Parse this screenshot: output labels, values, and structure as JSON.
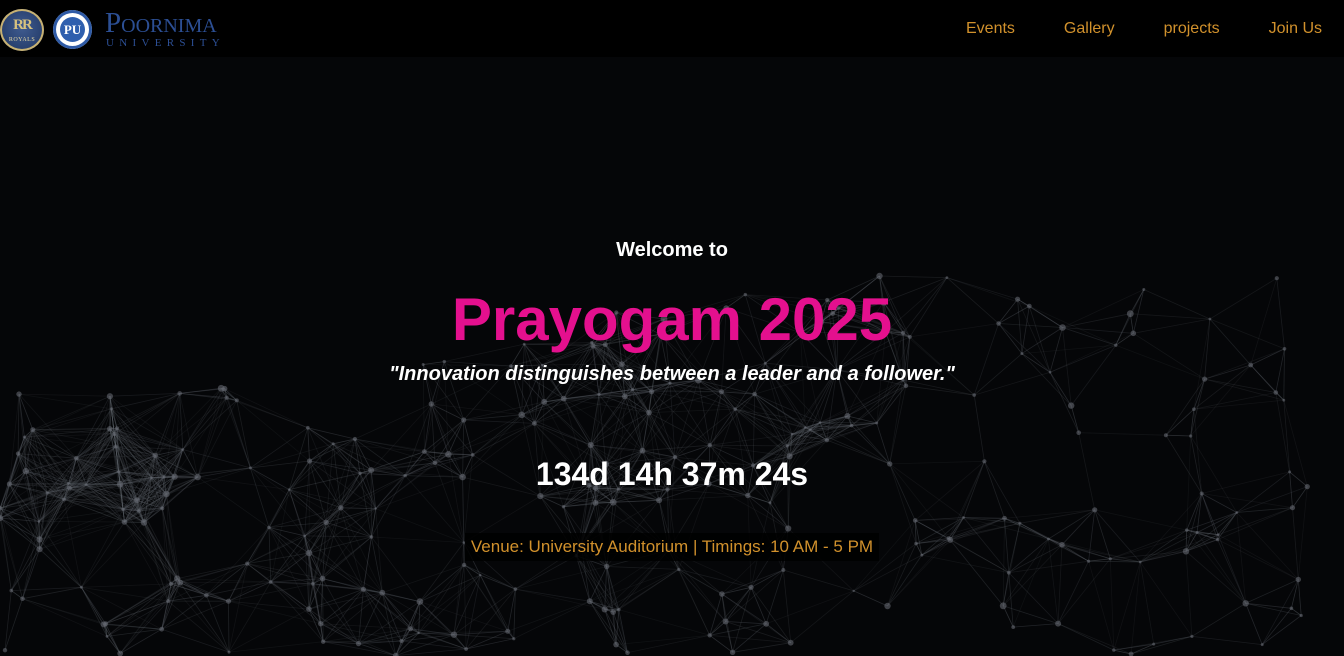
{
  "brand": {
    "royals_logo_text": "ROYALS",
    "pu_logo_text": "PU",
    "name": "Poornima",
    "subtitle": "UNIVERSITY"
  },
  "nav": {
    "items": [
      {
        "label": "Events"
      },
      {
        "label": "Gallery"
      },
      {
        "label": "projects"
      },
      {
        "label": "Join Us"
      }
    ]
  },
  "hero": {
    "welcome": "Welcome to",
    "title": "Prayogam 2025",
    "tagline": "\"Innovation distinguishes between a leader and a follower.\"",
    "countdown": "134d 14h 37m 24s",
    "venue": "Venue: University Auditorium | Timings: 10 AM - 5 PM"
  },
  "colors": {
    "background": "#050608",
    "navbar": "#000000",
    "accent_gold": "#d1912c",
    "title_pink": "#e4108e",
    "brand_blue": "#2c4f94",
    "network_lines": "#5a5f66"
  }
}
